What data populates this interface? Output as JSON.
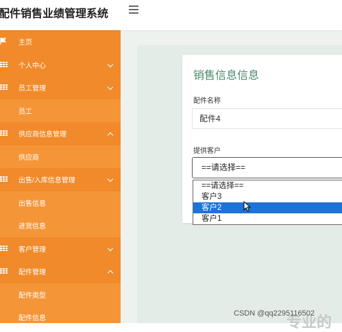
{
  "header": {
    "app_title": "配件销售业绩管理系统"
  },
  "sidebar": {
    "items": [
      {
        "label": "主页",
        "kind": "section",
        "icon": "flag-icon"
      },
      {
        "label": "个人中心",
        "kind": "section",
        "icon": "grid-icon",
        "chevron": "down"
      },
      {
        "label": "员工管理",
        "kind": "section",
        "icon": "grid-icon",
        "chevron": "down"
      },
      {
        "label": "员工",
        "kind": "sub"
      },
      {
        "label": "供应商信息管理",
        "kind": "section",
        "icon": "grid-icon",
        "chevron": "up"
      },
      {
        "label": "供应商",
        "kind": "sub"
      },
      {
        "label": "出售/入库信息管理",
        "kind": "section",
        "icon": "grid-icon",
        "chevron": "down"
      },
      {
        "label": "出售信息",
        "kind": "sub"
      },
      {
        "label": "进货信息",
        "kind": "sub"
      },
      {
        "label": "客户管理",
        "kind": "section",
        "icon": "grid-icon",
        "chevron": "down"
      },
      {
        "label": "配件管理",
        "kind": "section",
        "icon": "grid-icon",
        "chevron": "up"
      },
      {
        "label": "配件类型",
        "kind": "sub"
      },
      {
        "label": "配件信息",
        "kind": "sub"
      }
    ]
  },
  "form": {
    "title": "销售信息信息",
    "part_name_label": "配件名称",
    "part_name_value": "配件4",
    "customer_label": "提供客户",
    "customer_selected": "==请选择==",
    "customer_options": [
      "==请选择==",
      "客户3",
      "客户2",
      "客户1"
    ],
    "highlighted_option": "客户2"
  },
  "watermark": {
    "text": "CSDN @qq2295116502",
    "big_text": "专业的"
  },
  "colors": {
    "sidebar": "#f39031",
    "title": "#4a8a6a",
    "highlight": "#1e72d8"
  }
}
